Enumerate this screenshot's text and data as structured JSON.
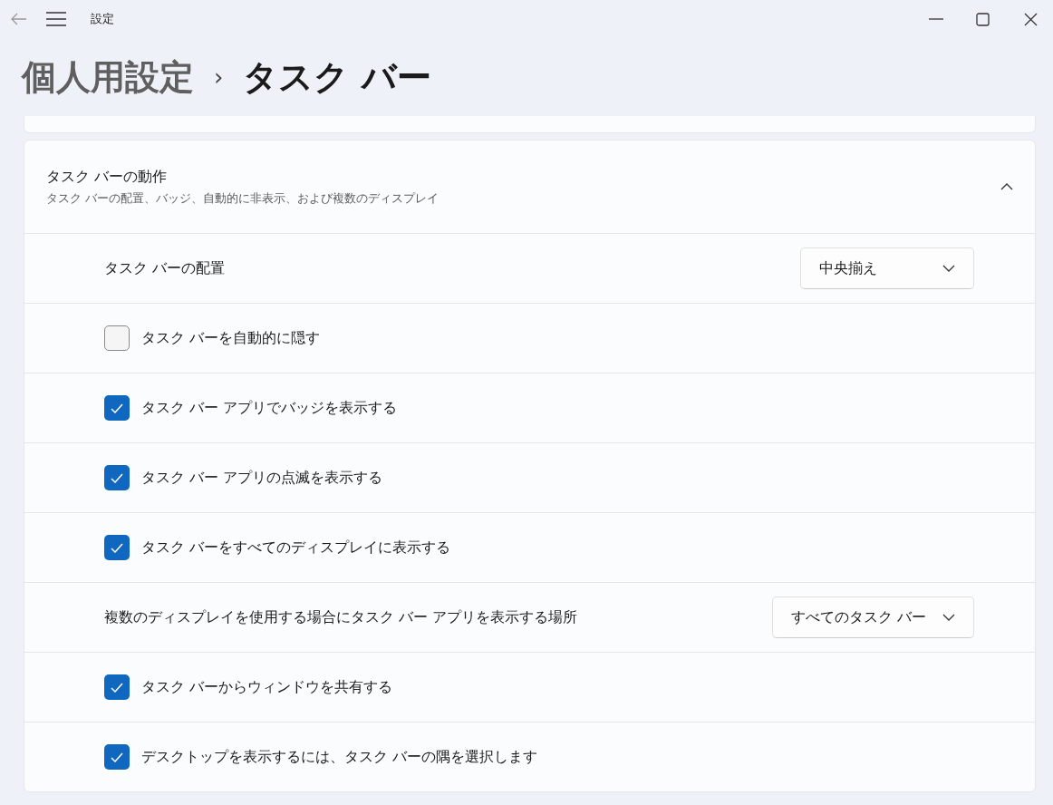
{
  "window": {
    "title": "設定"
  },
  "breadcrumb": {
    "parent": "個人用設定",
    "separator": "›",
    "current": "タスク バー"
  },
  "section": {
    "title": "タスク バーの動作",
    "subtitle": "タスク バーの配置、バッジ、自動的に非表示、および複数のディスプレイ",
    "expanded": true,
    "rows": [
      {
        "kind": "dropdown",
        "label": "タスク バーの配置",
        "value": "中央揃え"
      },
      {
        "kind": "checkbox",
        "label": "タスク バーを自動的に隠す",
        "checked": false
      },
      {
        "kind": "checkbox",
        "label": "タスク バー アプリでバッジを表示する",
        "checked": true
      },
      {
        "kind": "checkbox",
        "label": "タスク バー アプリの点滅を表示する",
        "checked": true
      },
      {
        "kind": "checkbox",
        "label": "タスク バーをすべてのディスプレイに表示する",
        "checked": true
      },
      {
        "kind": "dropdown",
        "label": "複数のディスプレイを使用する場合にタスク バー アプリを表示する場所",
        "value": "すべてのタスク バー"
      },
      {
        "kind": "checkbox",
        "label": "タスク バーからウィンドウを共有する",
        "checked": true
      },
      {
        "kind": "checkbox",
        "label": "デスクトップを表示するには、タスク バーの隅を選択します",
        "checked": true
      }
    ]
  }
}
